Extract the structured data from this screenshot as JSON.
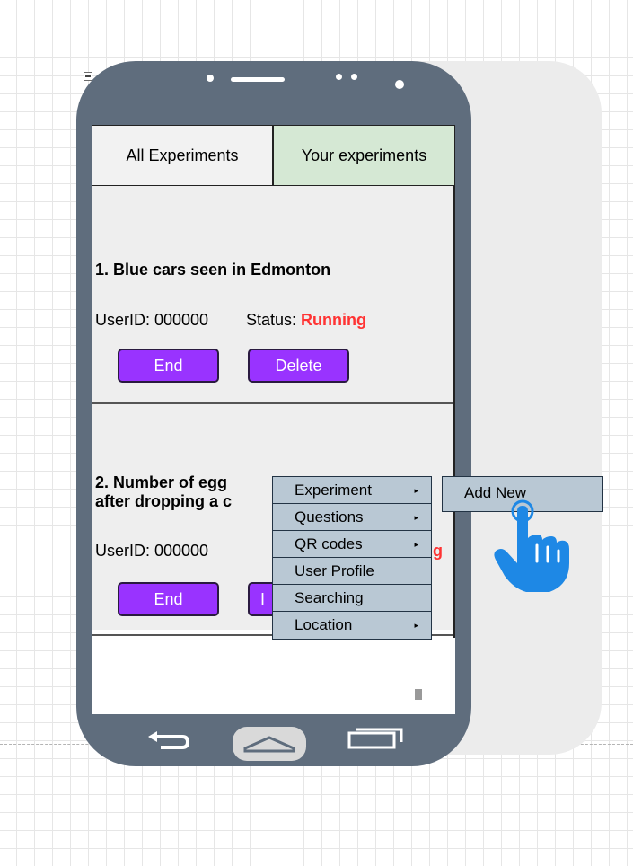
{
  "tabs": [
    {
      "label": "All Experiments"
    },
    {
      "label": "Your experiments"
    }
  ],
  "experiments": [
    {
      "title_line1": "1. Blue cars seen in Edmonton",
      "title_line2": "",
      "user_id": "UserID: 000000",
      "status_label": "Status: ",
      "status_value": "Running",
      "end_label": "End",
      "delete_label": "Delete"
    },
    {
      "title_line1": "2. Number of egg",
      "title_line2": "after dropping a c",
      "user_id": "UserID: 000000",
      "status_value_fragment": "g",
      "end_label": "End",
      "delete_label_fragment": "I"
    }
  ],
  "context_menu": {
    "items": [
      {
        "label": "Experiment",
        "arrow": "▸"
      },
      {
        "label": "Questions",
        "arrow": "▸"
      },
      {
        "label": "QR codes",
        "arrow": "▸"
      },
      {
        "label": "User Profile",
        "arrow": ""
      },
      {
        "label": "Searching",
        "arrow": ""
      },
      {
        "label": "Location",
        "arrow": "▸"
      }
    ],
    "submenu": {
      "label": "Add New"
    }
  },
  "colors": {
    "phone_body": "#5f6d7d",
    "tab_selected": "#d5e8d4",
    "button": "#9933ff",
    "status_running": "#ff3333",
    "menu_bg": "#b9c8d4",
    "pointer_hand": "#1e88e5"
  },
  "icons": {
    "back": "back-arrow-icon",
    "home": "home-icon",
    "recent": "recent-apps-icon",
    "pointer": "pointing-hand-icon",
    "collapse": "collapse-icon"
  }
}
